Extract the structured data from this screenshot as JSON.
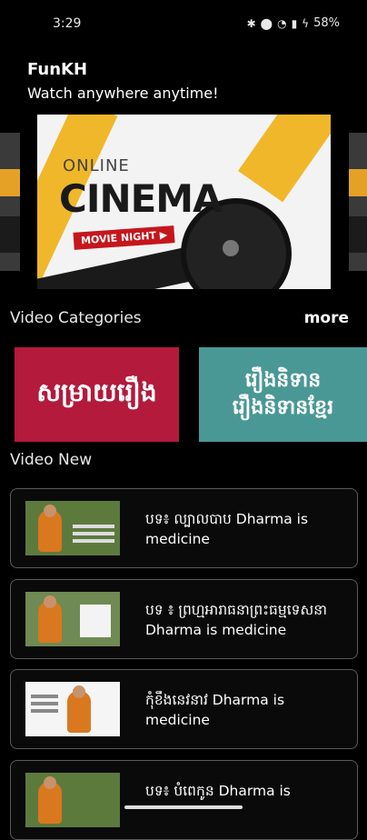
{
  "status": {
    "time": "3:29",
    "battery": "58%"
  },
  "header": {
    "title": "FunKH",
    "subtitle": "Watch anywhere anytime!"
  },
  "banner": {
    "line1": "ONLINE",
    "line2": "CINEMA",
    "tag": "MOVIE NIGHT ▶"
  },
  "categories": {
    "title": "Video Categories",
    "more": "more",
    "items": [
      {
        "label": "សម្រាយរឿង"
      },
      {
        "label": "រឿងនិទាន\nរឿងនិទានខ្មែរ"
      }
    ]
  },
  "new_videos": {
    "title": "Video New",
    "items": [
      {
        "title": "បទ៖ ល្បាលបាប Dharma is medicine"
      },
      {
        "title": "បទ ៖ ព្រហ្មអារាធនាព្រះធម្មទេសនា Dharma is medicine"
      },
      {
        "title": "កុំខឹងនេវនាវ Dharma is medicine"
      },
      {
        "title": "បទ៖ បំពេកូន Dharma is"
      }
    ]
  },
  "colors": {
    "background": "#000000",
    "category1": "#b31a3c",
    "category2": "#4a9896",
    "banner_accent": "#f1b72a"
  }
}
